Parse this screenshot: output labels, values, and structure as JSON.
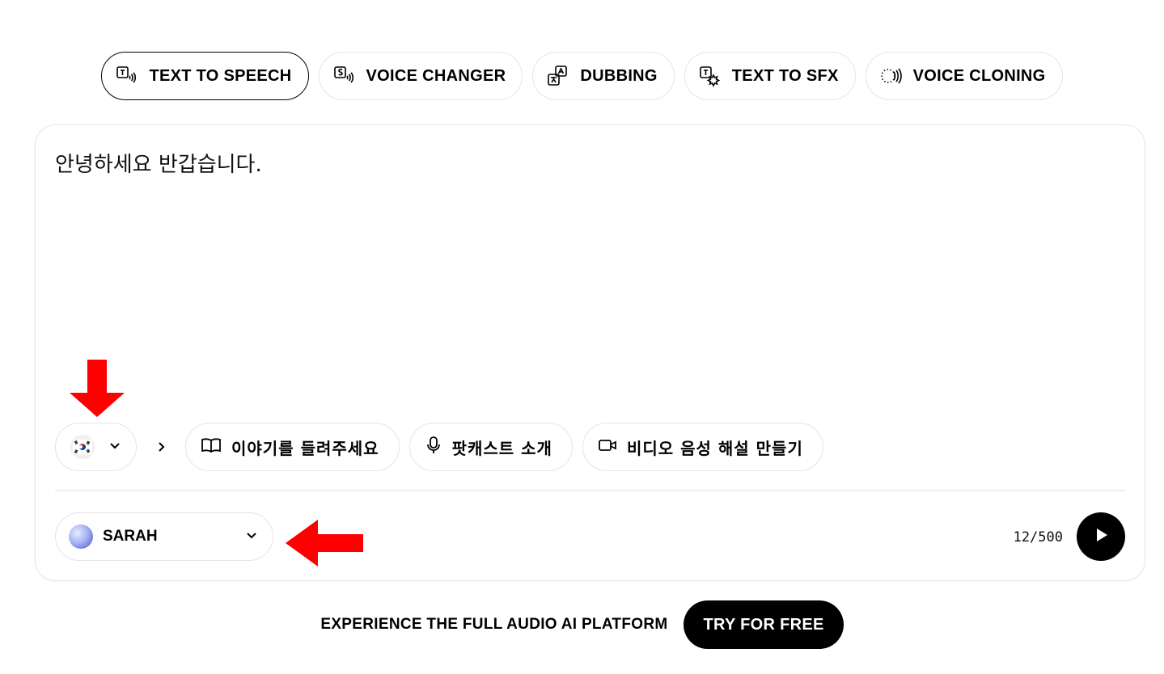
{
  "tabs": [
    {
      "label": "TEXT TO SPEECH",
      "icon": "text-to-speech-icon",
      "active": true
    },
    {
      "label": "VOICE CHANGER",
      "icon": "voice-changer-icon",
      "active": false
    },
    {
      "label": "DUBBING",
      "icon": "dubbing-icon",
      "active": false
    },
    {
      "label": "TEXT TO SFX",
      "icon": "text-to-sfx-icon",
      "active": false
    },
    {
      "label": "VOICE CLONING",
      "icon": "voice-cloning-icon",
      "active": false
    }
  ],
  "editor": {
    "text": "안녕하세요 반갑습니다.",
    "language_icon": "korea-flag-icon"
  },
  "suggestions": [
    {
      "label": "이야기를 들려주세요",
      "icon": "book-icon"
    },
    {
      "label": "팟캐스트 소개",
      "icon": "microphone-icon"
    },
    {
      "label": "비디오 음성 해설 만들기",
      "icon": "video-icon"
    }
  ],
  "voice": {
    "name": "SARAH"
  },
  "char_count": "12/500",
  "footer": {
    "text": "EXPERIENCE THE FULL AUDIO AI PLATFORM",
    "cta": "TRY FOR FREE"
  },
  "colors": {
    "accent": "#000000",
    "annotation_arrow": "#ff0000",
    "border": "#e5e5e5"
  }
}
